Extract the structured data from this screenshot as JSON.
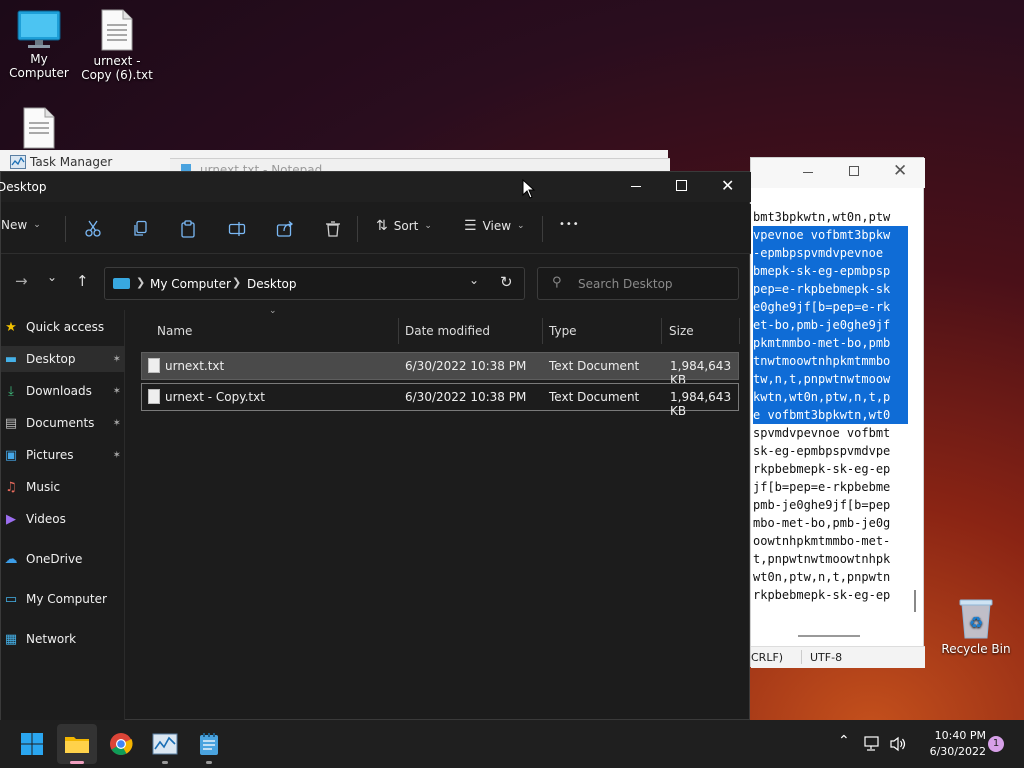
{
  "desktop": {
    "icons": [
      {
        "label": "My Computer",
        "icon": "monitor-icon"
      },
      {
        "label": "urnext - Copy (6).txt",
        "icon": "text-file-icon"
      },
      {
        "label": "",
        "icon": "text-file-icon"
      },
      {
        "label": "Recycle Bin",
        "icon": "recycle-bin-icon"
      }
    ]
  },
  "background_windows": {
    "task_manager_title": "Task Manager",
    "notepad_title_partial": "urnext.txt - Notepad"
  },
  "notepad": {
    "lines": [
      "bmt3bpkwtn,wt0n,ptw",
      "vpevnoe vofbmt3bpkw",
      "-epmbpspvmdvpevnoe",
      "bmepk-sk-eg-epmbpsp",
      "pep=e-rkpbebmepk-sk",
      "e0ghe9jf[b=pep=e-rk",
      "et-bo,pmb-je0ghe9jf",
      "pkmtmmbo-met-bo,pmb",
      "tnwtmoowtnhpkmtmmbo",
      "tw,n,t,pnpwtnwtmoow",
      "kwtn,wt0n,ptw,n,t,p",
      "e vofbmt3bpkwtn,wt0",
      "spvmdvpevnoe vofbmt",
      "sk-eg-epmbpspvmdvpe",
      "rkpbebmepk-sk-eg-ep",
      "jf[b=pep=e-rkpbebme",
      "pmb-je0ghe9jf[b=pep",
      "mbo-met-bo,pmb-je0g",
      "oowtnhpkmtmmbo-met-",
      "t,pnpwtnwtmoowtnhpk",
      "wt0n,ptw,n,t,pnpwtn",
      "rkpbebmepk-sk-eg-ep"
    ],
    "selected_from": 1,
    "selected_to": 11,
    "status_line_ending": "CRLF)",
    "status_encoding": "UTF-8"
  },
  "explorer": {
    "title": "Desktop",
    "toolbar": {
      "new_label": "New",
      "sort_label": "Sort",
      "view_label": "View",
      "more_label": "•••"
    },
    "address": {
      "root": "My Computer",
      "current": "Desktop"
    },
    "search_placeholder": "Search Desktop",
    "nav": [
      {
        "label": "Quick access",
        "icon": "star-icon",
        "pinned": false
      },
      {
        "label": "Desktop",
        "icon": "desktop-folder-icon",
        "pinned": true
      },
      {
        "label": "Downloads",
        "icon": "download-icon",
        "pinned": true
      },
      {
        "label": "Documents",
        "icon": "documents-icon",
        "pinned": true
      },
      {
        "label": "Pictures",
        "icon": "pictures-icon",
        "pinned": true
      },
      {
        "label": "Music",
        "icon": "music-icon",
        "pinned": false
      },
      {
        "label": "Videos",
        "icon": "videos-icon",
        "pinned": false
      },
      {
        "label": "OneDrive",
        "icon": "cloud-icon",
        "pinned": false
      },
      {
        "label": "My Computer",
        "icon": "computer-icon",
        "pinned": false
      },
      {
        "label": "Network",
        "icon": "network-icon",
        "pinned": false
      }
    ],
    "columns": [
      "Name",
      "Date modified",
      "Type",
      "Size"
    ],
    "files": [
      {
        "name": "urnext.txt",
        "date": "6/30/2022 10:38 PM",
        "type": "Text Document",
        "size": "1,984,643 KB"
      },
      {
        "name": "urnext - Copy.txt",
        "date": "6/30/2022 10:38 PM",
        "type": "Text Document",
        "size": "1,984,643 KB"
      }
    ]
  },
  "taskbar": {
    "apps": [
      "start-icon",
      "file-explorer-icon",
      "chrome-icon",
      "task-manager-icon",
      "notepad-icon"
    ],
    "time": "10:40 PM",
    "date": "6/30/2022",
    "notification_count": "1"
  },
  "colors": {
    "selection_blue": "#0f6cd6",
    "explorer_bg": "#1c1c1c",
    "taskbar_bg": "#1f1f1f"
  }
}
